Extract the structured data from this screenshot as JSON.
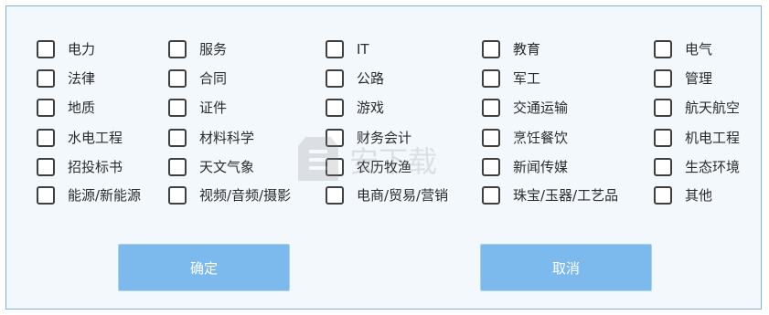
{
  "options": [
    [
      "电力",
      "服务",
      "IT",
      "教育",
      "电气"
    ],
    [
      "法律",
      "合同",
      "公路",
      "军工",
      "管理"
    ],
    [
      "地质",
      "证件",
      "游戏",
      "交通运输",
      "航天航空"
    ],
    [
      "水电工程",
      "材料科学",
      "财务会计",
      "烹饪餐饮",
      "机电工程"
    ],
    [
      "招投标书",
      "天文气象",
      "农历牧渔",
      "新闻传媒",
      "生态环境"
    ],
    [
      "能源/新能源",
      "视频/音频/摄影",
      "电商/贸易/营销",
      "珠宝/玉器/工艺品",
      "其他"
    ]
  ],
  "buttons": {
    "confirm": "确定",
    "cancel": "取消"
  },
  "watermark": {
    "text": "安下载"
  },
  "colors": {
    "dialog_bg": "#f3f8fd",
    "dialog_border": "#7fb1e3",
    "button_bg": "#7cb9ec",
    "checkbox_border": "#3f3f3f"
  }
}
